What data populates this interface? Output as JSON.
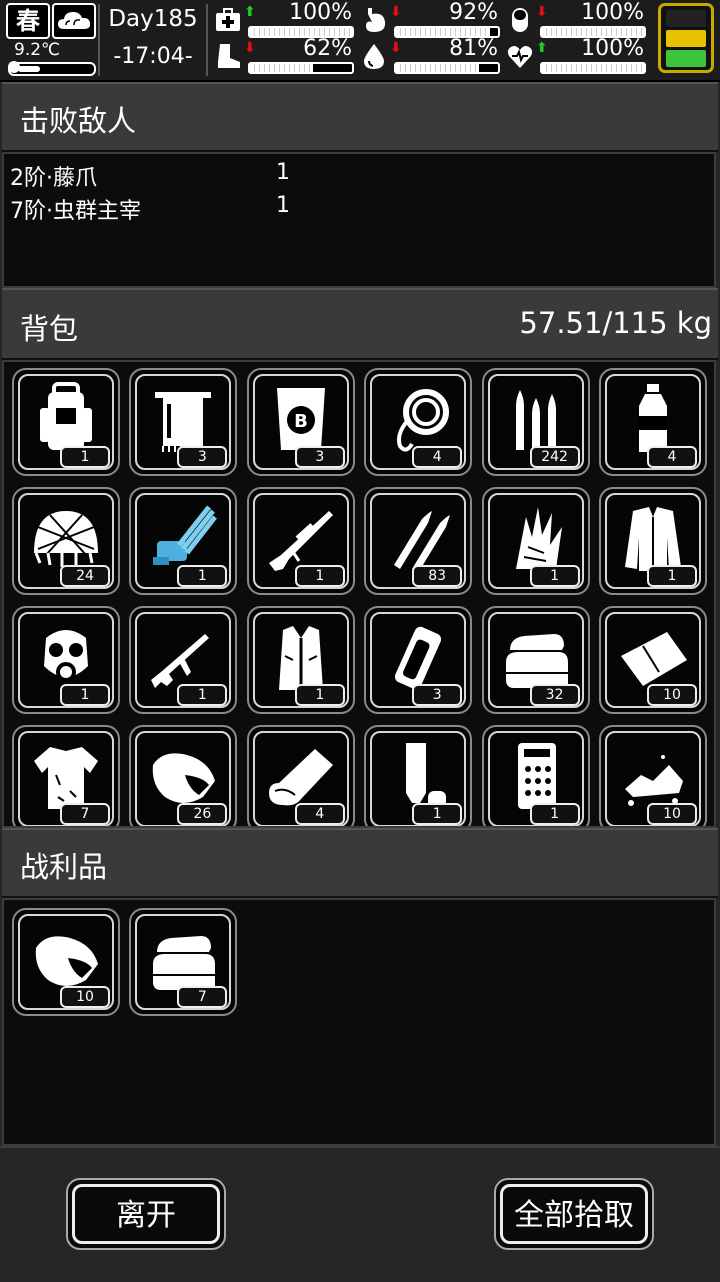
{
  "status": {
    "season": "春",
    "temperature": "9.2℃",
    "day": "Day185",
    "time": "-17:04-",
    "stats": [
      {
        "name": "health",
        "icon": "medkit-icon",
        "trend": "up",
        "value": "100%",
        "level": 1.0
      },
      {
        "name": "food",
        "icon": "stomach-icon",
        "trend": "down",
        "value": "92%",
        "level": 0.92
      },
      {
        "name": "medicine",
        "icon": "pill-icon",
        "trend": "down",
        "value": "100%",
        "level": 1.0
      },
      {
        "name": "stamina",
        "icon": "boot-icon",
        "trend": "down",
        "value": "62%",
        "level": 0.62
      },
      {
        "name": "water",
        "icon": "drop-icon",
        "trend": "down",
        "value": "81%",
        "level": 0.81
      },
      {
        "name": "mood",
        "icon": "heart-icon",
        "trend": "up",
        "value": "100%",
        "level": 1.0
      }
    ]
  },
  "defeated": {
    "title": "击败敌人",
    "enemies": [
      {
        "name": "2阶·藤爪",
        "count": "1"
      },
      {
        "name": "7阶·虫群主宰",
        "count": "1"
      }
    ]
  },
  "backpack": {
    "title": "背包",
    "weight": "57.51/115 kg",
    "items": [
      {
        "icon": "backpack-icon",
        "count": "1"
      },
      {
        "icon": "towel-icon",
        "count": "3"
      },
      {
        "icon": "bag-icon",
        "count": "3"
      },
      {
        "icon": "rope-icon",
        "count": "4"
      },
      {
        "icon": "bullets-icon",
        "count": "242"
      },
      {
        "icon": "bottle-icon",
        "count": "4"
      },
      {
        "icon": "helmet-net-icon",
        "count": "24"
      },
      {
        "icon": "minigun-icon",
        "count": "1"
      },
      {
        "icon": "sniper-rifle-icon",
        "count": "1"
      },
      {
        "icon": "rifle-ammo-icon",
        "count": "83"
      },
      {
        "icon": "grass-icon",
        "count": "1"
      },
      {
        "icon": "fur-coat-icon",
        "count": "1"
      },
      {
        "icon": "gas-mask-icon",
        "count": "1"
      },
      {
        "icon": "assault-rifle-icon",
        "count": "1"
      },
      {
        "icon": "fur-vest-icon",
        "count": "1"
      },
      {
        "icon": "can-icon",
        "count": "3"
      },
      {
        "icon": "cloth-stack-icon",
        "count": "32"
      },
      {
        "icon": "cloth-icon",
        "count": "10"
      },
      {
        "icon": "ragged-shirt-icon",
        "count": "7"
      },
      {
        "icon": "meat-icon",
        "count": "26"
      },
      {
        "icon": "blanket-icon",
        "count": "4"
      },
      {
        "icon": "tube-icon",
        "count": "1"
      },
      {
        "icon": "circuit-board-icon",
        "count": "1"
      },
      {
        "icon": "ore-icon",
        "count": "10"
      }
    ]
  },
  "loot": {
    "title": "战利品",
    "items": [
      {
        "icon": "meat-icon",
        "count": "10"
      },
      {
        "icon": "cloth-stack-icon",
        "count": "7"
      }
    ]
  },
  "buttons": {
    "leave": "离开",
    "take_all": "全部拾取"
  }
}
